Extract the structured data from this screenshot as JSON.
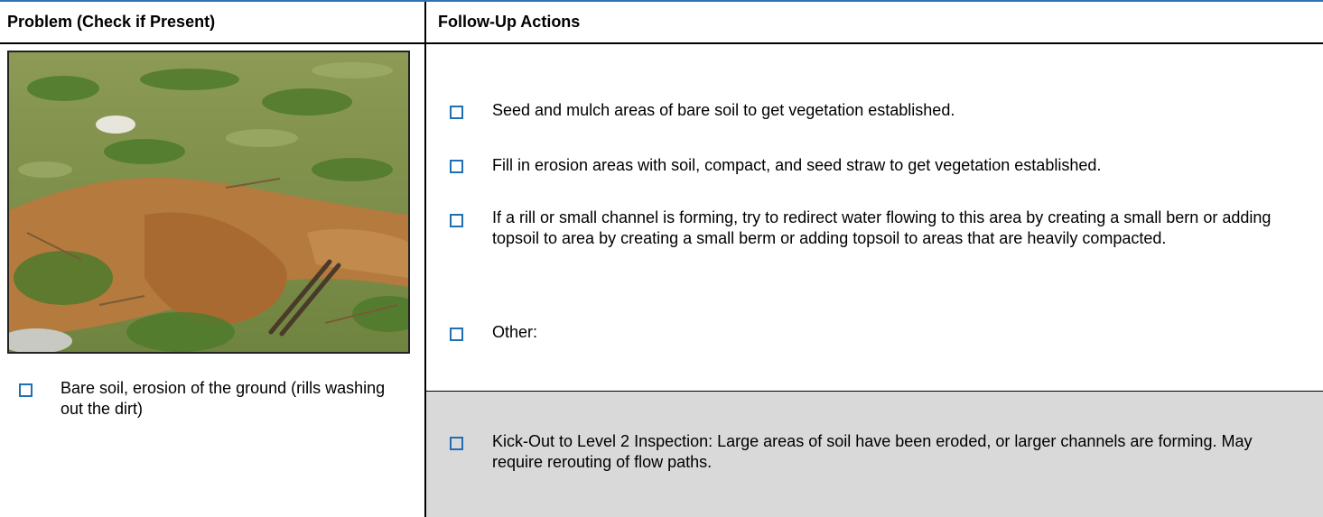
{
  "headers": {
    "problem": "Problem (Check if Present)",
    "actions": "Follow-Up Actions"
  },
  "problem": {
    "label": "Bare soil, erosion of the ground (rills washing out the dirt)"
  },
  "actions": [
    {
      "label": "Seed and mulch areas of bare soil to get vegetation established."
    },
    {
      "label": "Fill in erosion areas with soil, compact, and seed straw to get vegetation established."
    },
    {
      "label": "If a rill or small channel is forming, try to redirect water flowing to this area by creating a small bern or adding topsoil to area by creating a small berm or adding topsoil to areas that are heavily compacted."
    },
    {
      "label": "Other:"
    }
  ],
  "kick_out": {
    "label": "Kick-Out to Level 2 Inspection: Large areas of soil have been eroded, or larger channels are forming. May require rerouting of flow paths."
  },
  "colors": {
    "checkbox": "#1f6fb2",
    "shade": "#d9d9d9",
    "top_rule": "#2e74b5"
  }
}
